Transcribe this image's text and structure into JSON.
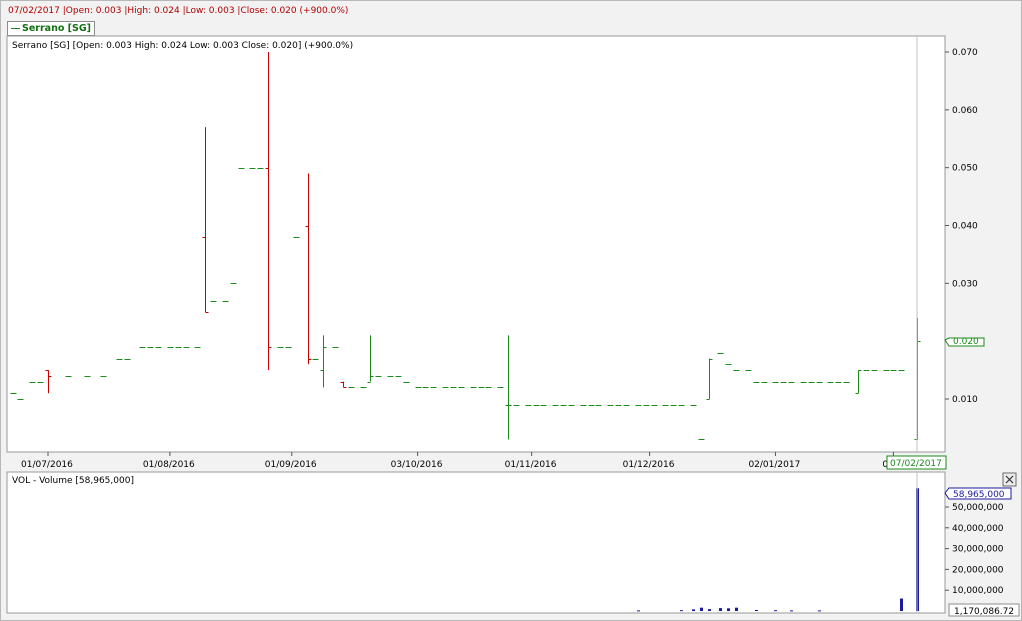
{
  "info_bar": {
    "date": "07/02/2017",
    "open": "|Open: 0.003",
    "high": "|High: 0.024",
    "low": "|Low: 0.003",
    "close": "|Close: 0.020",
    "change": "(+900.0%)"
  },
  "legend": {
    "label": "Serrano [SG]"
  },
  "price_panel": {
    "overlay": "Serrano [SG] [Open: 0.003  High: 0.024  Low: 0.003  Close: 0.020] (+900.0%)",
    "last_price_label": "0.020",
    "crosshair_date_label": "07/02/2017",
    "y_ticks": [
      "0.070",
      "0.060",
      "0.050",
      "0.040",
      "0.030",
      "0.020",
      "0.010"
    ],
    "x_ticks": [
      "01/07/2016",
      "01/08/2016",
      "01/09/2016",
      "03/10/2016",
      "01/11/2016",
      "01/12/2016",
      "02/01/2017",
      "01/0"
    ]
  },
  "volume_panel": {
    "overlay": "VOL - Volume [58,965,000]",
    "last_volume_label": "58,965,000",
    "bottom_label": "1,170,086.72",
    "y_ticks": [
      "50,000,000",
      "40,000,000",
      "30,000,000",
      "20,000,000",
      "10,000,000"
    ]
  },
  "colors": {
    "up": "#1a8a1a",
    "down": "#cc0000",
    "volume": "#1a1aa0",
    "info_text": "#b00000",
    "legend_text": "#107010"
  },
  "chart_data": [
    {
      "type": "ohlc",
      "title": "Serrano [SG]",
      "ylim": [
        0.0,
        0.072
      ],
      "x_range": [
        "2016-06-20",
        "2017-02-07"
      ],
      "grid": false,
      "legend_position": "top-left",
      "ohlc": [
        {
          "date": "2016-06-22",
          "open": 0.011,
          "high": 0.011,
          "low": 0.011,
          "close": 0.011
        },
        {
          "date": "2016-06-24",
          "open": 0.01,
          "high": 0.01,
          "low": 0.01,
          "close": 0.01
        },
        {
          "date": "2016-06-27",
          "open": 0.013,
          "high": 0.013,
          "low": 0.013,
          "close": 0.013
        },
        {
          "date": "2016-06-29",
          "open": 0.013,
          "high": 0.013,
          "low": 0.013,
          "close": 0.013
        },
        {
          "date": "2016-07-01",
          "open": 0.015,
          "high": 0.015,
          "low": 0.011,
          "close": 0.014
        },
        {
          "date": "2016-07-06",
          "open": 0.014,
          "high": 0.014,
          "low": 0.014,
          "close": 0.014
        },
        {
          "date": "2016-07-11",
          "open": 0.014,
          "high": 0.014,
          "low": 0.014,
          "close": 0.014
        },
        {
          "date": "2016-07-15",
          "open": 0.014,
          "high": 0.014,
          "low": 0.014,
          "close": 0.014
        },
        {
          "date": "2016-07-19",
          "open": 0.017,
          "high": 0.017,
          "low": 0.017,
          "close": 0.017
        },
        {
          "date": "2016-07-21",
          "open": 0.017,
          "high": 0.017,
          "low": 0.017,
          "close": 0.017
        },
        {
          "date": "2016-07-25",
          "open": 0.019,
          "high": 0.019,
          "low": 0.019,
          "close": 0.019
        },
        {
          "date": "2016-07-27",
          "open": 0.019,
          "high": 0.019,
          "low": 0.019,
          "close": 0.019
        },
        {
          "date": "2016-07-29",
          "open": 0.019,
          "high": 0.019,
          "low": 0.019,
          "close": 0.019
        },
        {
          "date": "2016-08-01",
          "open": 0.019,
          "high": 0.019,
          "low": 0.019,
          "close": 0.019
        },
        {
          "date": "2016-08-03",
          "open": 0.019,
          "high": 0.019,
          "low": 0.019,
          "close": 0.019
        },
        {
          "date": "2016-08-05",
          "open": 0.019,
          "high": 0.019,
          "low": 0.019,
          "close": 0.019
        },
        {
          "date": "2016-08-08",
          "open": 0.019,
          "high": 0.019,
          "low": 0.019,
          "close": 0.019
        },
        {
          "date": "2016-08-10",
          "open": 0.038,
          "high": 0.057,
          "low": 0.025,
          "close": 0.025
        },
        {
          "date": "2016-08-12",
          "open": 0.027,
          "high": 0.027,
          "low": 0.027,
          "close": 0.027
        },
        {
          "date": "2016-08-15",
          "open": 0.027,
          "high": 0.027,
          "low": 0.027,
          "close": 0.027
        },
        {
          "date": "2016-08-17",
          "open": 0.03,
          "high": 0.03,
          "low": 0.03,
          "close": 0.03
        },
        {
          "date": "2016-08-19",
          "open": 0.05,
          "high": 0.05,
          "low": 0.05,
          "close": 0.05
        },
        {
          "date": "2016-08-22",
          "open": 0.05,
          "high": 0.05,
          "low": 0.05,
          "close": 0.05
        },
        {
          "date": "2016-08-24",
          "open": 0.05,
          "high": 0.05,
          "low": 0.05,
          "close": 0.05
        },
        {
          "date": "2016-08-26",
          "open": 0.05,
          "high": 0.07,
          "low": 0.015,
          "close": 0.019
        },
        {
          "date": "2016-08-29",
          "open": 0.019,
          "high": 0.019,
          "low": 0.019,
          "close": 0.019
        },
        {
          "date": "2016-08-31",
          "open": 0.019,
          "high": 0.019,
          "low": 0.019,
          "close": 0.019
        },
        {
          "date": "2016-09-02",
          "open": 0.038,
          "high": 0.038,
          "low": 0.038,
          "close": 0.038
        },
        {
          "date": "2016-09-05",
          "open": 0.04,
          "high": 0.049,
          "low": 0.016,
          "close": 0.017
        },
        {
          "date": "2016-09-07",
          "open": 0.017,
          "high": 0.017,
          "low": 0.017,
          "close": 0.017
        },
        {
          "date": "2016-09-09",
          "open": 0.015,
          "high": 0.021,
          "low": 0.012,
          "close": 0.019
        },
        {
          "date": "2016-09-12",
          "open": 0.019,
          "high": 0.019,
          "low": 0.019,
          "close": 0.019
        },
        {
          "date": "2016-09-14",
          "open": 0.013,
          "high": 0.013,
          "low": 0.012,
          "close": 0.012
        },
        {
          "date": "2016-09-16",
          "open": 0.012,
          "high": 0.012,
          "low": 0.012,
          "close": 0.012
        },
        {
          "date": "2016-09-19",
          "open": 0.012,
          "high": 0.012,
          "low": 0.012,
          "close": 0.012
        },
        {
          "date": "2016-09-21",
          "open": 0.013,
          "high": 0.021,
          "low": 0.013,
          "close": 0.014
        },
        {
          "date": "2016-09-23",
          "open": 0.014,
          "high": 0.014,
          "low": 0.014,
          "close": 0.014
        },
        {
          "date": "2016-09-26",
          "open": 0.014,
          "high": 0.014,
          "low": 0.014,
          "close": 0.014
        },
        {
          "date": "2016-09-28",
          "open": 0.014,
          "high": 0.014,
          "low": 0.014,
          "close": 0.014
        },
        {
          "date": "2016-09-30",
          "open": 0.013,
          "high": 0.013,
          "low": 0.013,
          "close": 0.013
        },
        {
          "date": "2016-10-03",
          "open": 0.012,
          "high": 0.012,
          "low": 0.012,
          "close": 0.012
        },
        {
          "date": "2016-10-05",
          "open": 0.012,
          "high": 0.012,
          "low": 0.012,
          "close": 0.012
        },
        {
          "date": "2016-10-07",
          "open": 0.012,
          "high": 0.012,
          "low": 0.012,
          "close": 0.012
        },
        {
          "date": "2016-10-10",
          "open": 0.012,
          "high": 0.012,
          "low": 0.012,
          "close": 0.012
        },
        {
          "date": "2016-10-12",
          "open": 0.012,
          "high": 0.012,
          "low": 0.012,
          "close": 0.012
        },
        {
          "date": "2016-10-14",
          "open": 0.012,
          "high": 0.012,
          "low": 0.012,
          "close": 0.012
        },
        {
          "date": "2016-10-17",
          "open": 0.012,
          "high": 0.012,
          "low": 0.012,
          "close": 0.012
        },
        {
          "date": "2016-10-19",
          "open": 0.012,
          "high": 0.012,
          "low": 0.012,
          "close": 0.012
        },
        {
          "date": "2016-10-21",
          "open": 0.012,
          "high": 0.012,
          "low": 0.012,
          "close": 0.012
        },
        {
          "date": "2016-10-24",
          "open": 0.012,
          "high": 0.012,
          "low": 0.012,
          "close": 0.012
        },
        {
          "date": "2016-10-26",
          "open": 0.009,
          "high": 0.021,
          "low": 0.003,
          "close": 0.009
        },
        {
          "date": "2016-10-28",
          "open": 0.009,
          "high": 0.009,
          "low": 0.009,
          "close": 0.009
        },
        {
          "date": "2016-10-31",
          "open": 0.009,
          "high": 0.009,
          "low": 0.009,
          "close": 0.009
        },
        {
          "date": "2016-11-02",
          "open": 0.009,
          "high": 0.009,
          "low": 0.009,
          "close": 0.009
        },
        {
          "date": "2016-11-04",
          "open": 0.009,
          "high": 0.009,
          "low": 0.009,
          "close": 0.009
        },
        {
          "date": "2016-11-07",
          "open": 0.009,
          "high": 0.009,
          "low": 0.009,
          "close": 0.009
        },
        {
          "date": "2016-11-09",
          "open": 0.009,
          "high": 0.009,
          "low": 0.009,
          "close": 0.009
        },
        {
          "date": "2016-11-11",
          "open": 0.009,
          "high": 0.009,
          "low": 0.009,
          "close": 0.009
        },
        {
          "date": "2016-11-14",
          "open": 0.009,
          "high": 0.009,
          "low": 0.009,
          "close": 0.009
        },
        {
          "date": "2016-11-16",
          "open": 0.009,
          "high": 0.009,
          "low": 0.009,
          "close": 0.009
        },
        {
          "date": "2016-11-18",
          "open": 0.009,
          "high": 0.009,
          "low": 0.009,
          "close": 0.009
        },
        {
          "date": "2016-11-21",
          "open": 0.009,
          "high": 0.009,
          "low": 0.009,
          "close": 0.009
        },
        {
          "date": "2016-11-23",
          "open": 0.009,
          "high": 0.009,
          "low": 0.009,
          "close": 0.009
        },
        {
          "date": "2016-11-25",
          "open": 0.009,
          "high": 0.009,
          "low": 0.009,
          "close": 0.009
        },
        {
          "date": "2016-11-28",
          "open": 0.009,
          "high": 0.009,
          "low": 0.009,
          "close": 0.009
        },
        {
          "date": "2016-11-30",
          "open": 0.009,
          "high": 0.009,
          "low": 0.009,
          "close": 0.009
        },
        {
          "date": "2016-12-02",
          "open": 0.009,
          "high": 0.009,
          "low": 0.009,
          "close": 0.009
        },
        {
          "date": "2016-12-05",
          "open": 0.009,
          "high": 0.009,
          "low": 0.009,
          "close": 0.009
        },
        {
          "date": "2016-12-07",
          "open": 0.009,
          "high": 0.009,
          "low": 0.009,
          "close": 0.009
        },
        {
          "date": "2016-12-09",
          "open": 0.009,
          "high": 0.009,
          "low": 0.009,
          "close": 0.009
        },
        {
          "date": "2016-12-12",
          "open": 0.009,
          "high": 0.009,
          "low": 0.009,
          "close": 0.009
        },
        {
          "date": "2016-12-14",
          "open": 0.003,
          "high": 0.003,
          "low": 0.003,
          "close": 0.003
        },
        {
          "date": "2016-12-16",
          "open": 0.01,
          "high": 0.017,
          "low": 0.01,
          "close": 0.017
        },
        {
          "date": "2016-12-19",
          "open": 0.018,
          "high": 0.018,
          "low": 0.018,
          "close": 0.018
        },
        {
          "date": "2016-12-21",
          "open": 0.016,
          "high": 0.016,
          "low": 0.016,
          "close": 0.016
        },
        {
          "date": "2016-12-23",
          "open": 0.015,
          "high": 0.015,
          "low": 0.015,
          "close": 0.015
        },
        {
          "date": "2016-12-26",
          "open": 0.015,
          "high": 0.015,
          "low": 0.015,
          "close": 0.015
        },
        {
          "date": "2016-12-28",
          "open": 0.013,
          "high": 0.013,
          "low": 0.013,
          "close": 0.013
        },
        {
          "date": "2016-12-30",
          "open": 0.013,
          "high": 0.013,
          "low": 0.013,
          "close": 0.013
        },
        {
          "date": "2017-01-02",
          "open": 0.013,
          "high": 0.013,
          "low": 0.013,
          "close": 0.013
        },
        {
          "date": "2017-01-04",
          "open": 0.013,
          "high": 0.013,
          "low": 0.013,
          "close": 0.013
        },
        {
          "date": "2017-01-06",
          "open": 0.013,
          "high": 0.013,
          "low": 0.013,
          "close": 0.013
        },
        {
          "date": "2017-01-09",
          "open": 0.013,
          "high": 0.013,
          "low": 0.013,
          "close": 0.013
        },
        {
          "date": "2017-01-11",
          "open": 0.013,
          "high": 0.013,
          "low": 0.013,
          "close": 0.013
        },
        {
          "date": "2017-01-13",
          "open": 0.013,
          "high": 0.013,
          "low": 0.013,
          "close": 0.013
        },
        {
          "date": "2017-01-16",
          "open": 0.013,
          "high": 0.013,
          "low": 0.013,
          "close": 0.013
        },
        {
          "date": "2017-01-18",
          "open": 0.013,
          "high": 0.013,
          "low": 0.013,
          "close": 0.013
        },
        {
          "date": "2017-01-20",
          "open": 0.013,
          "high": 0.013,
          "low": 0.013,
          "close": 0.013
        },
        {
          "date": "2017-01-23",
          "open": 0.011,
          "high": 0.015,
          "low": 0.011,
          "close": 0.015
        },
        {
          "date": "2017-01-25",
          "open": 0.015,
          "high": 0.015,
          "low": 0.015,
          "close": 0.015
        },
        {
          "date": "2017-01-27",
          "open": 0.015,
          "high": 0.015,
          "low": 0.015,
          "close": 0.015
        },
        {
          "date": "2017-01-30",
          "open": 0.015,
          "high": 0.015,
          "low": 0.015,
          "close": 0.015
        },
        {
          "date": "2017-02-01",
          "open": 0.015,
          "high": 0.015,
          "low": 0.015,
          "close": 0.015
        },
        {
          "date": "2017-02-03",
          "open": 0.015,
          "high": 0.015,
          "low": 0.015,
          "close": 0.015
        },
        {
          "date": "2017-02-07",
          "open": 0.003,
          "high": 0.024,
          "low": 0.003,
          "close": 0.02
        }
      ]
    },
    {
      "type": "bar",
      "title": "VOL - Volume",
      "ylim": [
        0,
        62000000
      ],
      "x": [
        "2016-11-28",
        "2016-12-09",
        "2016-12-12",
        "2016-12-14",
        "2016-12-16",
        "2016-12-19",
        "2016-12-21",
        "2016-12-23",
        "2016-12-28",
        "2017-01-02",
        "2017-01-06",
        "2017-01-13",
        "2017-02-03",
        "2017-02-07"
      ],
      "values": [
        300000,
        400000,
        800000,
        1600000,
        900000,
        1400000,
        1300000,
        1600000,
        500000,
        400000,
        300000,
        300000,
        6000000,
        58965000
      ]
    }
  ]
}
